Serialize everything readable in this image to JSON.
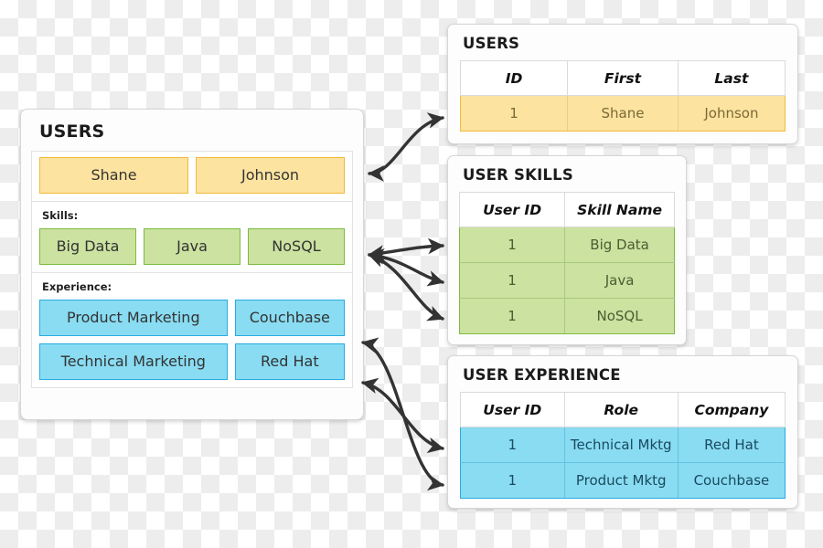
{
  "document_card": {
    "title": "USERS",
    "name_row": {
      "first": "Shane",
      "last": "Johnson"
    },
    "skills_section": {
      "label": "Skills:",
      "items": [
        "Big Data",
        "Java",
        "NoSQL"
      ]
    },
    "experience_section": {
      "label": "Experience:",
      "rows": [
        {
          "role": "Product Marketing",
          "company": "Couchbase"
        },
        {
          "role": "Technical Marketing",
          "company": "Red Hat"
        }
      ]
    }
  },
  "tables": {
    "users": {
      "title": "USERS",
      "columns": [
        "ID",
        "First",
        "Last"
      ],
      "rows": [
        [
          "1",
          "Shane",
          "Johnson"
        ]
      ]
    },
    "user_skills": {
      "title": "USER SKILLS",
      "columns": [
        "User ID",
        "Skill Name"
      ],
      "rows": [
        [
          "1",
          "Big Data"
        ],
        [
          "1",
          "Java"
        ],
        [
          "1",
          "NoSQL"
        ]
      ]
    },
    "user_experience": {
      "title": "USER EXPERIENCE",
      "columns": [
        "User ID",
        "Role",
        "Company"
      ],
      "rows": [
        [
          "1",
          "Technical Mktg",
          "Red Hat"
        ],
        [
          "1",
          "Product Mktg",
          "Couchbase"
        ]
      ]
    }
  },
  "colors": {
    "yellow_fill": "#fce3a0",
    "yellow_border": "#f2b93c",
    "green_fill": "#cbe2a0",
    "green_border": "#7dbb42",
    "blue_fill": "#89dcf2",
    "blue_border": "#29abe2",
    "arrow": "#333333",
    "card_border": "#d6d6d6"
  },
  "arrows": {
    "count": 6,
    "style": "double-headed-curved",
    "connections": [
      "document-name-row <-> users-table-row-1",
      "document-skills <-> user-skills-row-1",
      "document-skills <-> user-skills-row-2",
      "document-skills <-> user-skills-row-3",
      "document-experience-row-1 <-> user-experience-row-2",
      "document-experience-row-2 <-> user-experience-row-1"
    ]
  }
}
